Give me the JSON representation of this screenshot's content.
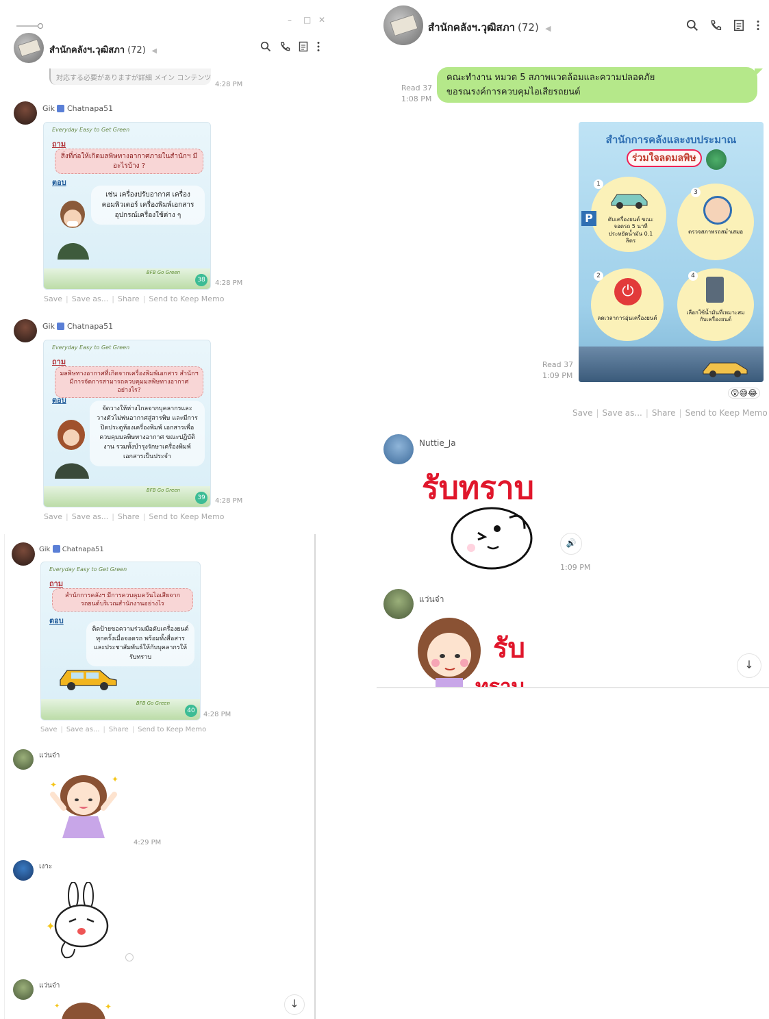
{
  "left_window": {
    "title": "สำนักคลังฯ.วุฒิสภา",
    "count": "(72)",
    "window_controls": {
      "minimize": "–",
      "maximize": "□",
      "close": "✕"
    },
    "preview_snippet": "対応する必要がありますが詳細 メイン コンテンツに...",
    "preview_time": "4:28 PM",
    "messages": [
      {
        "sender": "Gik",
        "sender_tag": "Chatnapa51",
        "time": "4:28 PM",
        "card": {
          "brand": "Everyday Easy to Get Green",
          "q_label": "ถาม",
          "question": "สิ่งที่ก่อให้เกิดมลพิษทางอากาศภายในสำนักฯ มีอะไรบ้าง ?",
          "a_label": "ตอบ",
          "answer": "เช่น เครื่องปรับอากาศ เครื่องคอมพิวเตอร์ เครื่องพิมพ์เอกสาร อุปกรณ์เครื่องใช้ต่าง ๆ",
          "bfb": "BFB Go Green",
          "badge": "38"
        },
        "actions": [
          "Save",
          "Save as...",
          "Share",
          "Send to Keep Memo"
        ]
      },
      {
        "sender": "Gik",
        "sender_tag": "Chatnapa51",
        "time": "4:28 PM",
        "card": {
          "brand": "Everyday Easy to Get Green",
          "q_label": "ถาม",
          "question": "มลพิษทางอากาศที่เกิดจากเครื่องพิมพ์เอกสาร สำนักฯ มีการจัดการสามารถควบคุมมลพิษทางอากาศอย่างไร?",
          "a_label": "ตอบ",
          "answer": "จัดวางให้ห่างไกลจากบุคลากรและวางตัวไม่พ่นอากาศสู่สารพิษ และมีการปิดประตูห้องเครื่องพิมพ์ เอกสารเพื่อควบคุมมลพิษทางอากาศ ขณะปฏิบัติงาน รวมทั้งบำรุงรักษาเครื่องพิมพ์เอกสารเป็นประจำ",
          "bfb": "BFB Go Green",
          "badge": "39"
        },
        "actions": [
          "Save",
          "Save as...",
          "Share",
          "Send to Keep Memo"
        ]
      },
      {
        "sender": "Gik",
        "sender_tag": "Chatnapa51",
        "time": "4:28 PM",
        "card": {
          "brand": "Everyday Easy to Get Green",
          "q_label": "ถาม",
          "question": "สำนักการคลังฯ มีการควบคุมควันไอเสียจากรถยนต์บริเวณสำนักงานอย่างไร",
          "a_label": "ตอบ",
          "answer": "ติดป้ายขอความร่วมมือดับเครื่องยนต์ทุกครั้งเมื่อจอดรถ พร้อมทั้งสื่อสารและประชาสัมพันธ์ให้กับบุคลากรให้รับทราบ",
          "bfb": "BFB Go Green",
          "badge": "40"
        },
        "actions": [
          "Save",
          "Save as...",
          "Share",
          "Send to Keep Memo"
        ]
      },
      {
        "sender": "แว่นจ๋า",
        "time": "4:29 PM"
      },
      {
        "sender": "เงาะ"
      },
      {
        "sender": "แว่นจ๋า"
      }
    ]
  },
  "right_window": {
    "title": "สำนักคลังฯ.วุฒิสภา",
    "count": "(72)",
    "sent_text": {
      "lines": [
        "คณะทำงาน หมวด 5 สภาพแวดล้อมและความปลอดภัย",
        "ขอรณรงค์การควบคุมไอเสียรถยนต์"
      ],
      "read": "Read 37",
      "time": "1:08 PM"
    },
    "poster": {
      "title": "สำนักการคลังและงบประมาณ",
      "subtitle": "ร่วมใจลดมลพิษ",
      "items": [
        {
          "num": "1",
          "text": "ดับเครื่องยนต์ ขณะจอดรถ 5 นาที ประหยัดน้ำมัน 0.1 ลิตร"
        },
        {
          "num": "3",
          "text": "ตรวจสภาพรถสม่ำเสมอ"
        },
        {
          "num": "2",
          "text": "ลดเวลาการอุ่นเครื่องยนต์"
        },
        {
          "num": "4",
          "text": "เลือกใช้น้ำมันที่เหมาะสมกับเครื่องยนต์"
        }
      ],
      "read": "Read 37",
      "time": "1:09 PM",
      "reactions": "😲😅😂",
      "actions": [
        "Save",
        "Save as...",
        "Share",
        "Send to Keep Memo"
      ]
    },
    "nuttie": {
      "sender": "Nuttie_Ja",
      "sticker_text": "รับทราบ",
      "time": "1:09 PM"
    },
    "waen": {
      "sender": "แว่นจ๋า",
      "sticker_text": "รับ",
      "sticker_text2": "ทราบ"
    }
  },
  "icons": {
    "search": "search-icon",
    "call": "phone-icon",
    "notes": "notes-icon",
    "menu": "kebab-menu-icon",
    "mute": "speaker-icon",
    "scroll_down": "arrow-down-icon"
  },
  "colors": {
    "bubble_green": "#b5e88a",
    "link_gray": "#a8a8a8",
    "badge_teal": "#3cbc95"
  }
}
